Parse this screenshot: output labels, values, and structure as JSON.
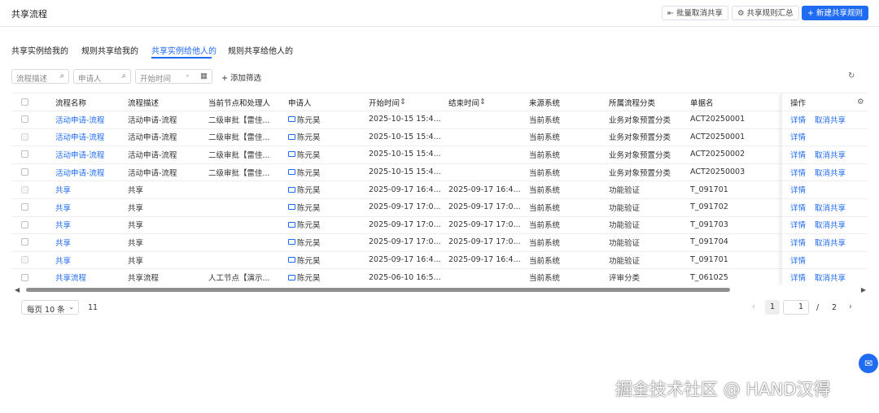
{
  "header": {
    "title": "共享流程",
    "batch_cancel": "批量取消共享",
    "rule_summary": "共享规则汇总",
    "new_rule": "新建共享规则"
  },
  "tabs": [
    "共享实例给我的",
    "规则共享给我的",
    "共享实例给他人的",
    "规则共享给他人的"
  ],
  "active_tab": 2,
  "filters": {
    "process_desc": "流程描述",
    "applicant": "申请人",
    "start_time": "开始时间",
    "add_filter": "添加筛选"
  },
  "table": {
    "columns": [
      "流程名称",
      "流程描述",
      "当前节点和处理人",
      "申请人",
      "开始时间",
      "结束时间",
      "来源系统",
      "所属流程分类",
      "单据名",
      "操作"
    ],
    "rows": [
      {
        "name": "活动申请-流程",
        "desc": "活动申请-流程",
        "node": "二级审批【雷佳...",
        "applicant": "陈元昊",
        "start": "2025-10-15 15:4...",
        "end": "",
        "source": "当前系统",
        "category": "业务对象预置分类",
        "doc": "ACT20250001",
        "ops": [
          "详情",
          "取消共享"
        ],
        "disabled": false
      },
      {
        "name": "活动申请-流程",
        "desc": "活动申请-流程",
        "node": "二级审批【雷佳...",
        "applicant": "陈元昊",
        "start": "2025-10-15 15:4...",
        "end": "",
        "source": "当前系统",
        "category": "业务对象预置分类",
        "doc": "ACT20250001",
        "ops": [
          "详情"
        ],
        "disabled": true
      },
      {
        "name": "活动申请-流程",
        "desc": "活动申请-流程",
        "node": "二级审批【雷佳...",
        "applicant": "陈元昊",
        "start": "2025-10-15 15:4...",
        "end": "",
        "source": "当前系统",
        "category": "业务对象预置分类",
        "doc": "ACT20250002",
        "ops": [
          "详情",
          "取消共享"
        ],
        "disabled": false
      },
      {
        "name": "活动申请-流程",
        "desc": "活动申请-流程",
        "node": "二级审批【雷佳...",
        "applicant": "陈元昊",
        "start": "2025-10-15 15:4...",
        "end": "",
        "source": "当前系统",
        "category": "业务对象预置分类",
        "doc": "ACT20250003",
        "ops": [
          "详情",
          "取消共享"
        ],
        "disabled": false
      },
      {
        "name": "共享",
        "desc": "共享",
        "node": "",
        "applicant": "陈元昊",
        "start": "2025-09-17 16:4...",
        "end": "2025-09-17 16:4...",
        "source": "当前系统",
        "category": "功能验证",
        "doc": "T_091701",
        "ops": [
          "详情"
        ],
        "disabled": true
      },
      {
        "name": "共享",
        "desc": "共享",
        "node": "",
        "applicant": "陈元昊",
        "start": "2025-09-17 17:0...",
        "end": "2025-09-17 17:0...",
        "source": "当前系统",
        "category": "功能验证",
        "doc": "T_091702",
        "ops": [
          "详情",
          "取消共享"
        ],
        "disabled": false
      },
      {
        "name": "共享",
        "desc": "共享",
        "node": "",
        "applicant": "陈元昊",
        "start": "2025-09-17 17:0...",
        "end": "2025-09-17 17:0...",
        "source": "当前系统",
        "category": "功能验证",
        "doc": "T_091703",
        "ops": [
          "详情",
          "取消共享"
        ],
        "disabled": false
      },
      {
        "name": "共享",
        "desc": "共享",
        "node": "",
        "applicant": "陈元昊",
        "start": "2025-09-17 17:0...",
        "end": "2025-09-17 17:0...",
        "source": "当前系统",
        "category": "功能验证",
        "doc": "T_091704",
        "ops": [
          "详情",
          "取消共享"
        ],
        "disabled": false
      },
      {
        "name": "共享",
        "desc": "共享",
        "node": "",
        "applicant": "陈元昊",
        "start": "2025-09-17 16:4...",
        "end": "2025-09-17 16:4...",
        "source": "当前系统",
        "category": "功能验证",
        "doc": "T_091701",
        "ops": [
          "详情"
        ],
        "disabled": true
      },
      {
        "name": "共享流程",
        "desc": "共享流程",
        "node": "人工节点【演示...",
        "applicant": "陈元昊",
        "start": "2025-06-10 16:5...",
        "end": "",
        "source": "当前系统",
        "category": "评审分类",
        "doc": "T_061025",
        "ops": [
          "详情",
          "取消共享"
        ],
        "disabled": false
      }
    ]
  },
  "pagination": {
    "page_size": "每页 10 条",
    "total": "11",
    "current": "1",
    "input": "1",
    "slash": "/",
    "total_pages": "2"
  },
  "watermark": "掘金技术社区 @ HAND汉得",
  "icons": {
    "search": "search-icon",
    "calendar": "calendar-icon",
    "refresh": "refresh-icon",
    "settings": "gear-icon",
    "sort": "sort-icon",
    "chat": "chat-icon"
  },
  "colors": {
    "primary": "#1f6bf2"
  }
}
